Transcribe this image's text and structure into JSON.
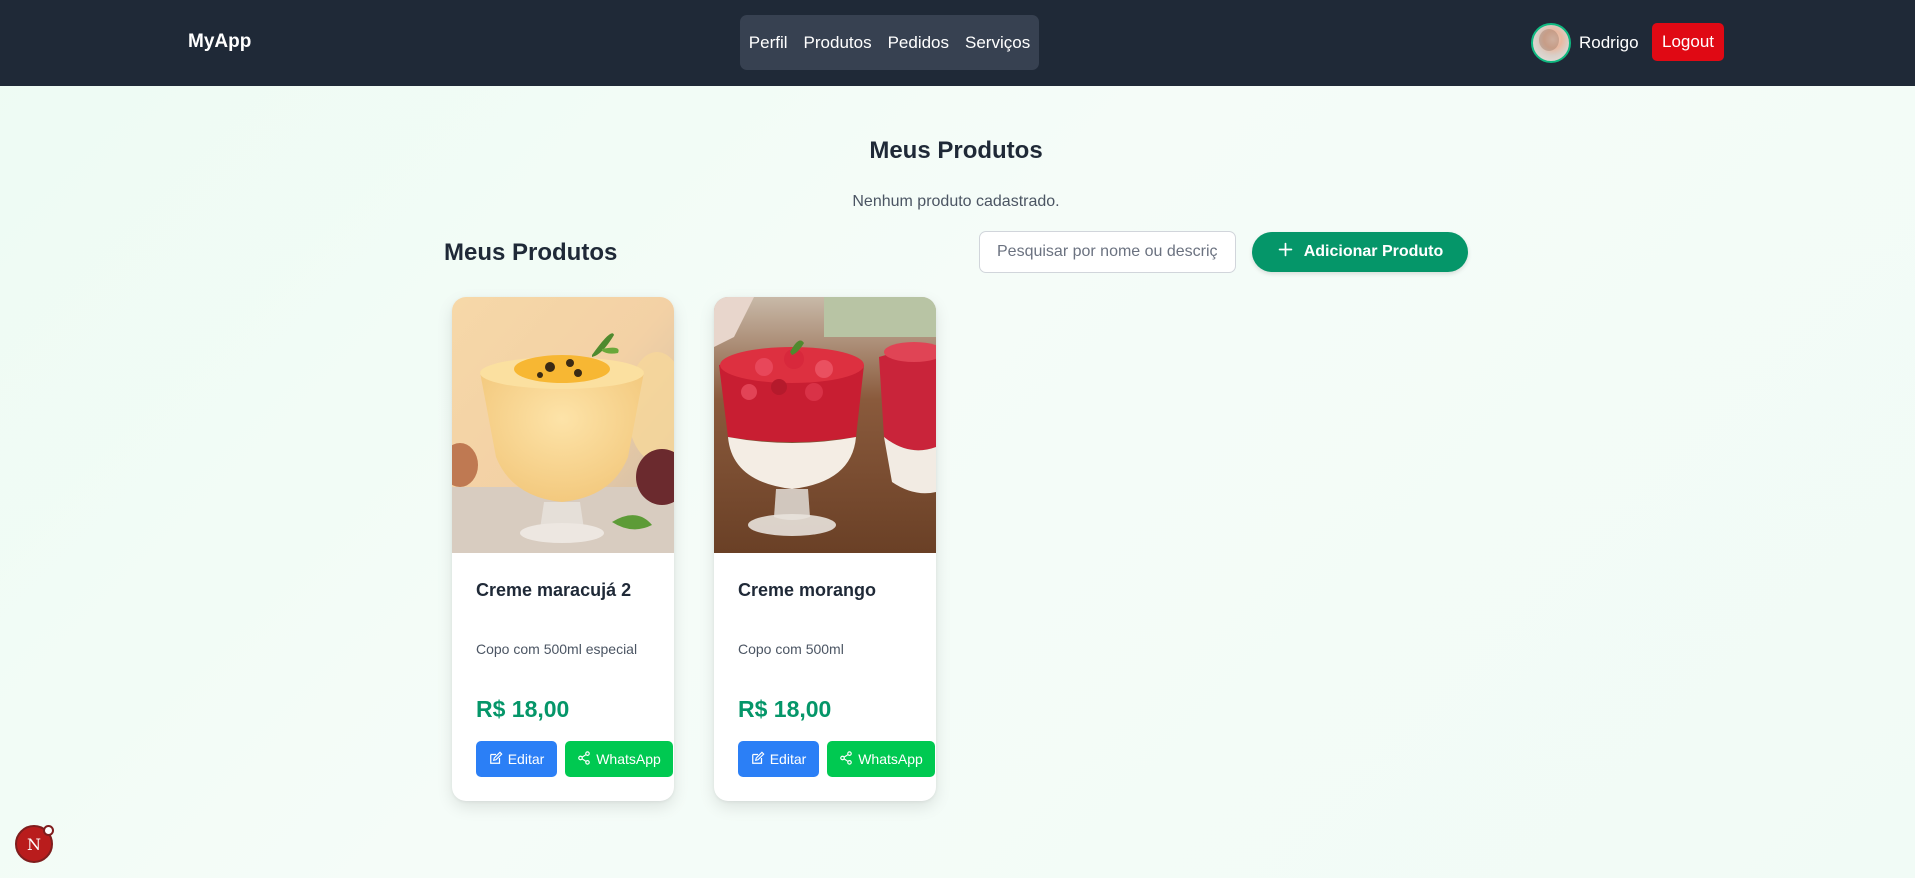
{
  "navbar": {
    "brand": "MyApp",
    "links": [
      {
        "label": "Perfil"
      },
      {
        "label": "Produtos"
      },
      {
        "label": "Pedidos"
      },
      {
        "label": "Serviços"
      }
    ],
    "user": {
      "name": "Rodrigo",
      "avatar_icon": "user-avatar"
    },
    "logout_label": "Logout"
  },
  "main": {
    "page_title": "Meus Produtos",
    "empty_message": "Nenhum produto cadastrado.",
    "section_title": "Meus Produtos",
    "search": {
      "placeholder": "Pesquisar por nome ou descrição",
      "value": ""
    },
    "add_button": {
      "label": "Adicionar Produto",
      "icon": "plus-icon"
    }
  },
  "products": [
    {
      "name": "Creme maracujá 2",
      "description": "Copo com 500ml especial",
      "price": "R$ 18,00",
      "image": "passion-fruit-mousse-photo",
      "edit_label": "Editar",
      "whatsapp_label": "WhatsApp"
    },
    {
      "name": "Creme morango",
      "description": "Copo com 500ml",
      "price": "R$ 18,00",
      "image": "strawberry-cream-photo",
      "edit_label": "Editar",
      "whatsapp_label": "WhatsApp"
    }
  ],
  "dev_badge": {
    "label": "N"
  },
  "colors": {
    "navbar_bg": "#1f2937",
    "nav_group_bg": "#374151",
    "logout": "#e00914",
    "accent_green": "#059669",
    "edit_blue": "#2b7ff6",
    "whatsapp_green": "#00c951"
  }
}
